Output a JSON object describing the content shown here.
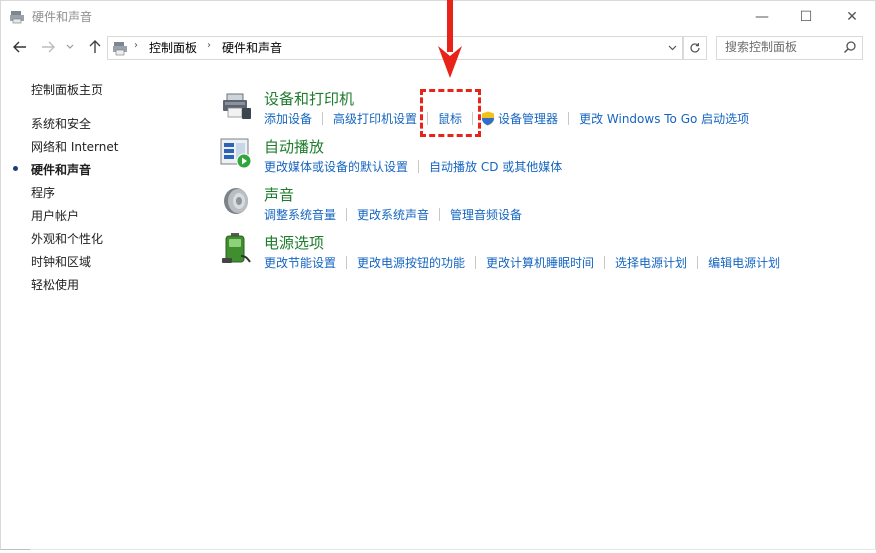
{
  "window": {
    "title": "硬件和声音",
    "controls": {
      "minimize": "—",
      "maximize": "☐",
      "close": "✕"
    }
  },
  "nav": {
    "breadcrumbs": [
      "控制面板",
      "硬件和声音"
    ],
    "search_placeholder": "搜索控制面板"
  },
  "sidebar": {
    "items": [
      {
        "label": "控制面板主页"
      },
      {
        "label": "系统和安全"
      },
      {
        "label": "网络和 Internet"
      },
      {
        "label": "硬件和声音",
        "current": true
      },
      {
        "label": "程序"
      },
      {
        "label": "用户帐户"
      },
      {
        "label": "外观和个性化"
      },
      {
        "label": "时钟和区域"
      },
      {
        "label": "轻松使用"
      }
    ]
  },
  "categories": [
    {
      "title": "设备和打印机",
      "icon": "printer-icon",
      "links": [
        "添加设备",
        "高级打印机设置",
        "鼠标",
        "设备管理器",
        "更改 Windows To Go 启动选项"
      ]
    },
    {
      "title": "自动播放",
      "icon": "autoplay-icon",
      "links": [
        "更改媒体或设备的默认设置",
        "自动播放 CD 或其他媒体"
      ]
    },
    {
      "title": "声音",
      "icon": "speaker-icon",
      "links": [
        "调整系统音量",
        "更改系统声音",
        "管理音频设备"
      ]
    },
    {
      "title": "电源选项",
      "icon": "battery-icon",
      "links": [
        "更改节能设置",
        "更改电源按钮的功能",
        "更改计算机睡眠时间",
        "选择电源计划",
        "编辑电源计划"
      ]
    }
  ],
  "colors": {
    "category_title": "#1e7c2c",
    "link": "#1565c0",
    "annotation": "#e8231a"
  }
}
